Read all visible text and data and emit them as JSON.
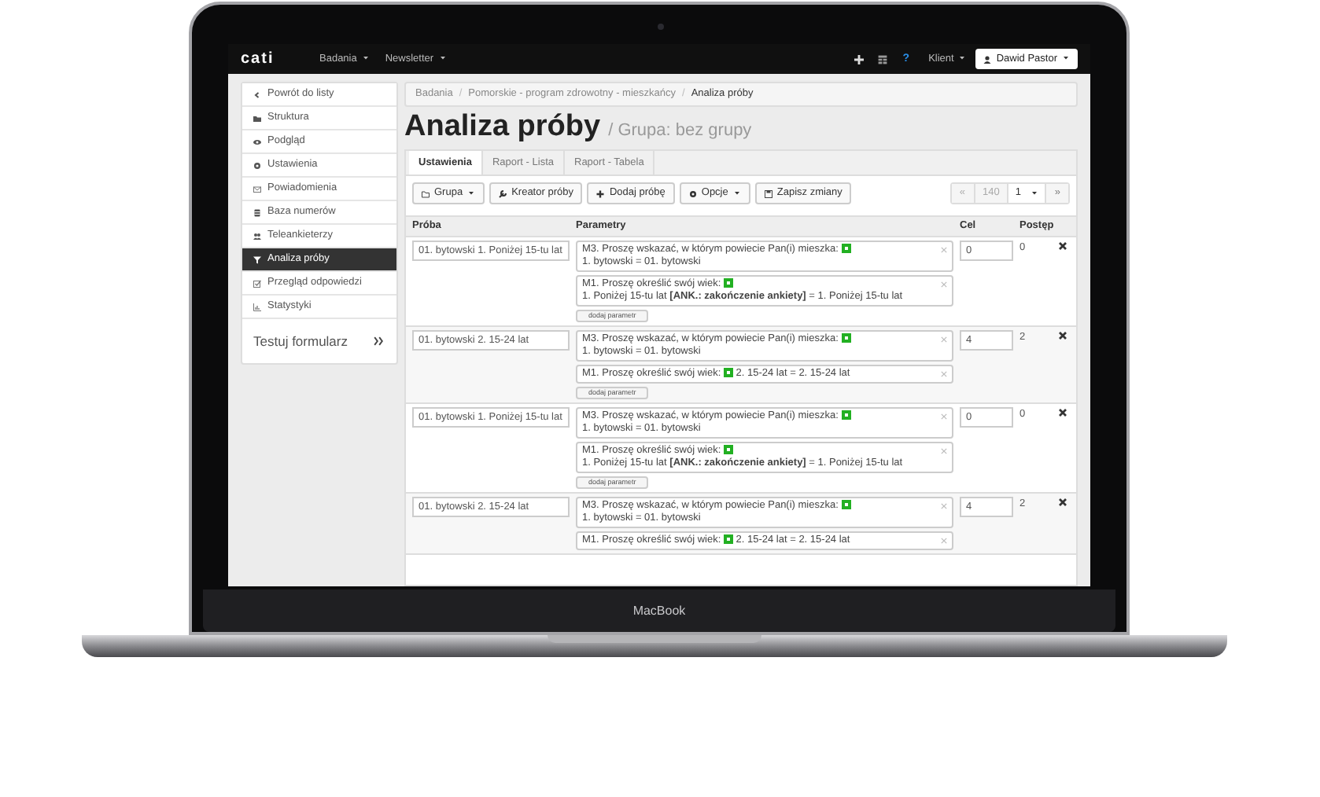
{
  "device": {
    "label": "MacBook"
  },
  "navbar": {
    "logo": "cati",
    "menus": [
      {
        "label": "Badania"
      },
      {
        "label": "Newsletter"
      }
    ],
    "help": "?",
    "client": "Klient",
    "user": "Dawid Pastor"
  },
  "sidebar": {
    "items": [
      {
        "label": "Powrót do listy",
        "selected": false
      },
      {
        "label": "Struktura",
        "selected": false
      },
      {
        "label": "Podgląd",
        "selected": false
      },
      {
        "label": "Ustawienia",
        "selected": false
      },
      {
        "label": "Powiadomienia",
        "selected": false
      },
      {
        "label": "Baza numerów",
        "selected": false
      },
      {
        "label": "Teleankieterzy",
        "selected": false
      },
      {
        "label": "Analiza próby",
        "selected": true
      },
      {
        "label": "Przegląd odpowiedzi",
        "selected": false
      },
      {
        "label": "Statystyki",
        "selected": false
      }
    ],
    "test_link": "Testuj formularz"
  },
  "breadcrumb": [
    {
      "kind": "link",
      "text": "Badania"
    },
    {
      "kind": "separator",
      "text": "/"
    },
    {
      "kind": "link",
      "text": "Pomorskie - program zdrowotny - mieszkańcy"
    },
    {
      "kind": "separator",
      "text": "/"
    },
    {
      "kind": "current",
      "text": "Analiza próby"
    }
  ],
  "title": "Analiza próby",
  "subtitle": "/ Grupa: bez grupy",
  "tabs": [
    {
      "label": "Ustawienia",
      "selected": true
    },
    {
      "label": "Raport - Lista",
      "selected": false
    },
    {
      "label": "Raport - Tabela",
      "selected": false
    }
  ],
  "toolbar": [
    {
      "label": "Grupa",
      "dropdown": true
    },
    {
      "label": "Kreator próby",
      "dropdown": false
    },
    {
      "label": "Dodaj próbę",
      "dropdown": false
    },
    {
      "label": "Opcje",
      "dropdown": true
    },
    {
      "label": "Zapisz zmiany",
      "dropdown": false
    }
  ],
  "pagination": {
    "prev": "«",
    "total": "140",
    "page": "1",
    "next": "»"
  },
  "table": {
    "columns": [
      "Próba",
      "Parametry",
      "Cel",
      "Postęp"
    ],
    "rows": [
      {
        "sample": "01. bytowski 1. Poniżej 15-tu lat",
        "params": [
          {
            "question": "M3. Proszę wskazać, w którym powiecie Pan(i) mieszka:",
            "answer": "1. bytowski = 01. bytowski"
          },
          {
            "question": "M1. Proszę określić swój wiek:",
            "answer": "1. Poniżej 15-tu lat **[ANK.: zakończenie ankiety]** = 1. Poniżej 15-tu lat"
          }
        ],
        "add_param": "dodaj parametr",
        "target": "0",
        "progress": "0"
      },
      {
        "sample": "01. bytowski 2. 15-24 lat",
        "params": [
          {
            "question": "M3. Proszę wskazać, w którym powiecie Pan(i) mieszka:",
            "answer": "1. bytowski = 01. bytowski"
          },
          {
            "question": "M1. Proszę określić swój wiek:",
            "answer": "2. 15-24 lat = 2. 15-24 lat"
          }
        ],
        "add_param": "dodaj parametr",
        "target": "4",
        "progress": "2"
      },
      {
        "sample": "01. bytowski 1. Poniżej 15-tu lat",
        "params": [
          {
            "question": "M3. Proszę wskazać, w którym powiecie Pan(i) mieszka:",
            "answer": "1. bytowski = 01. bytowski"
          },
          {
            "question": "M1. Proszę określić swój wiek:",
            "answer": "1. Poniżej 15-tu lat **[ANK.: zakończenie ankiety]** = 1. Poniżej 15-tu lat"
          }
        ],
        "add_param": "dodaj parametr",
        "target": "0",
        "progress": "0"
      },
      {
        "sample": "01. bytowski 2. 15-24 lat",
        "params": [
          {
            "question": "M3. Proszę wskazać, w którym powiecie Pan(i) mieszka:",
            "answer": "1. bytowski = 01. bytowski"
          },
          {
            "question": "M1. Proszę określić swój wiek:",
            "answer": "2. 15-24 lat = 2. 15-24 lat"
          }
        ],
        "target": "4",
        "progress": "2"
      }
    ]
  }
}
